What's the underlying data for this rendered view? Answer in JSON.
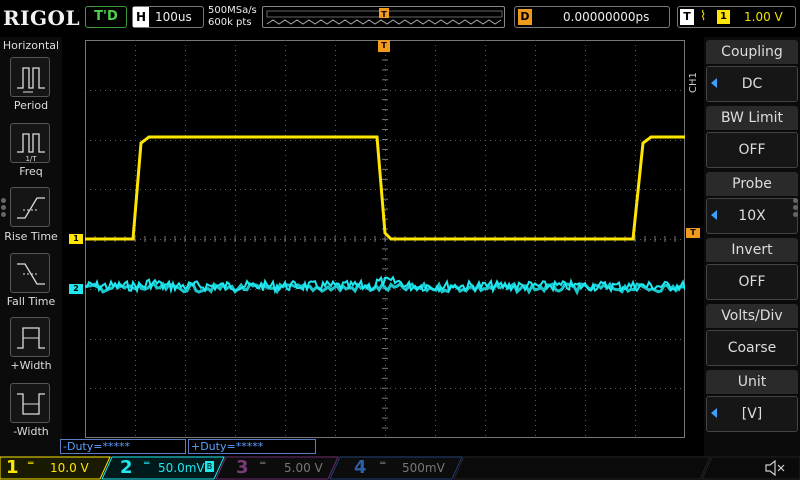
{
  "brand": "RIGOL",
  "topbar": {
    "status": "T'D",
    "horizontal": {
      "key": "H",
      "value": "100us"
    },
    "sample_rate": "500MSa/s",
    "memory_depth": "600k pts",
    "delay": {
      "key": "D",
      "value": "0.00000000ps"
    },
    "trigger": {
      "key": "T",
      "edge": "⌇",
      "channel": "1",
      "level": "1.00 V"
    }
  },
  "left_menu": {
    "title": "Horizontal",
    "items": [
      {
        "label": "Period",
        "icon": "period-icon"
      },
      {
        "label": "Freq",
        "icon": "freq-icon"
      },
      {
        "label": "Rise Time",
        "icon": "rise-time-icon"
      },
      {
        "label": "Fall Time",
        "icon": "fall-time-icon"
      },
      {
        "label": "+Width",
        "icon": "positive-width-icon"
      },
      {
        "label": "-Width",
        "icon": "negative-width-icon"
      }
    ]
  },
  "right_menu": {
    "channel_tag": "CH1",
    "items": [
      {
        "label": "Coupling",
        "value": "DC",
        "has_arrow": true
      },
      {
        "label": "BW Limit",
        "value": "OFF",
        "has_arrow": false
      },
      {
        "label": "Probe",
        "value": "10X",
        "has_arrow": true
      },
      {
        "label": "Invert",
        "value": "OFF",
        "has_arrow": false
      },
      {
        "label": "Volts/Div",
        "value": "Coarse",
        "has_arrow": false
      },
      {
        "label": "Unit",
        "value": "[V]",
        "has_arrow": true
      }
    ]
  },
  "markers": {
    "ch1": "1",
    "ch2": "2",
    "trigger": "T"
  },
  "measurements": [
    {
      "label": "-Duty=*****",
      "color": "#5ba0ff"
    },
    {
      "label": "+Duty=*****",
      "color": "#5ba0ff"
    }
  ],
  "channels": [
    {
      "num": "1",
      "scale": "10.0 V",
      "color": "#ffe600"
    },
    {
      "num": "2",
      "scale": "50.0mV",
      "color": "#1ee8f0"
    },
    {
      "num": "3",
      "scale": "5.00 V",
      "color": "#c040c0"
    },
    {
      "num": "4",
      "scale": "500mV",
      "color": "#3a7bd5"
    }
  ],
  "colors": {
    "ch1": "#ffe600",
    "ch2": "#1ee8f0",
    "trigger": "#f39a1c",
    "grid": "#5a5a5a"
  }
}
